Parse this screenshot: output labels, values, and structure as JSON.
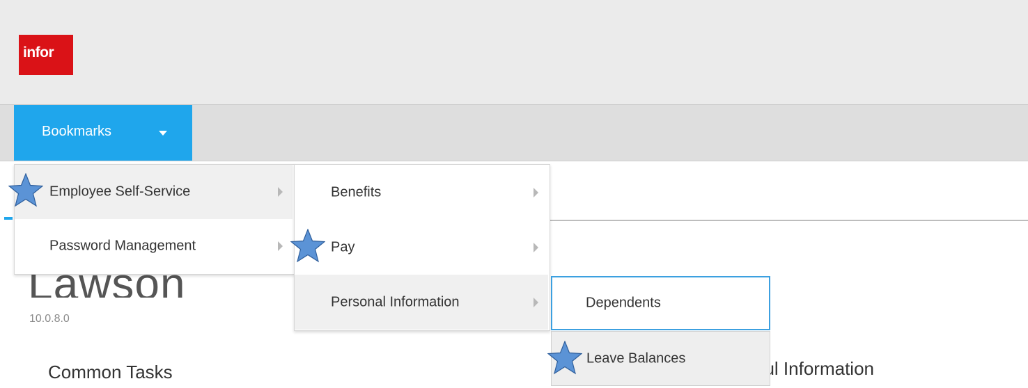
{
  "header": {
    "logo_text": "infor"
  },
  "nav": {
    "bookmarks_label": "Bookmarks"
  },
  "menu_level1": [
    {
      "label": "Employee Self-Service"
    },
    {
      "label": "Password Management"
    }
  ],
  "menu_level2": [
    {
      "label": "Benefits"
    },
    {
      "label": "Pay"
    },
    {
      "label": "Personal Information"
    }
  ],
  "menu_level3": [
    {
      "label": "Dependents"
    },
    {
      "label": "Leave Balances"
    }
  ],
  "page": {
    "product_name": "Lawson",
    "version": "10.0.8.0",
    "common_tasks": "Common Tasks",
    "useful_information": "Useful Information"
  },
  "colors": {
    "logo_red": "#da1217",
    "accent_blue": "#1fa6ec",
    "star_fill": "#5b93d6"
  },
  "icons": {
    "star": "star-icon",
    "arrow": "chevron-right-icon",
    "caret": "caret-down-icon"
  }
}
